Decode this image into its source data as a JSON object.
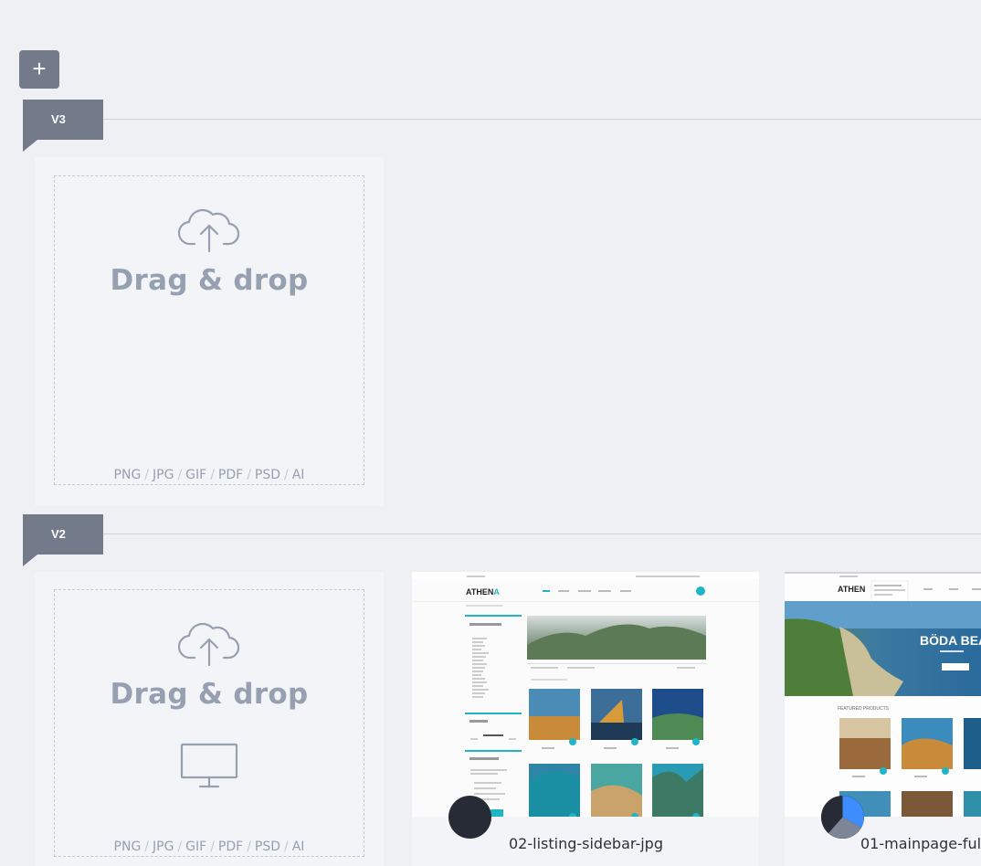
{
  "toolbar": {
    "add_label": "+"
  },
  "versions": [
    {
      "label": "V3"
    },
    {
      "label": "V2"
    }
  ],
  "dropzone": {
    "title": "Drag & drop",
    "formats": [
      "PNG",
      "JPG",
      "GIF",
      "PDF",
      "PSD",
      "AI"
    ],
    "separator": "/",
    "upload_icon": "cloud-upload-icon",
    "desktop_icon": "monitor-icon"
  },
  "thumbnails": [
    {
      "name": "02-listing-sidebar-jpg",
      "mock": {
        "logo": "ATHEN",
        "logo_accent": "A",
        "nav": [
          "HOME",
          "PAGES",
          "PORTFOLIO",
          "ACCOUNT",
          "CONTACT"
        ],
        "sidebar_headings": [
          "DESTINATION",
          "PRICE",
          "COMMUNITY"
        ]
      }
    },
    {
      "name": "01-mainpage-ful",
      "mock": {
        "logo": "ATHEN",
        "hero_text": "BÖDA BEAC",
        "section": "FEATURED PRODUCTS"
      }
    }
  ],
  "colors": {
    "accent": "#1fb5c4",
    "tag_bg": "#737b8a",
    "text_muted": "#96a0b0"
  }
}
